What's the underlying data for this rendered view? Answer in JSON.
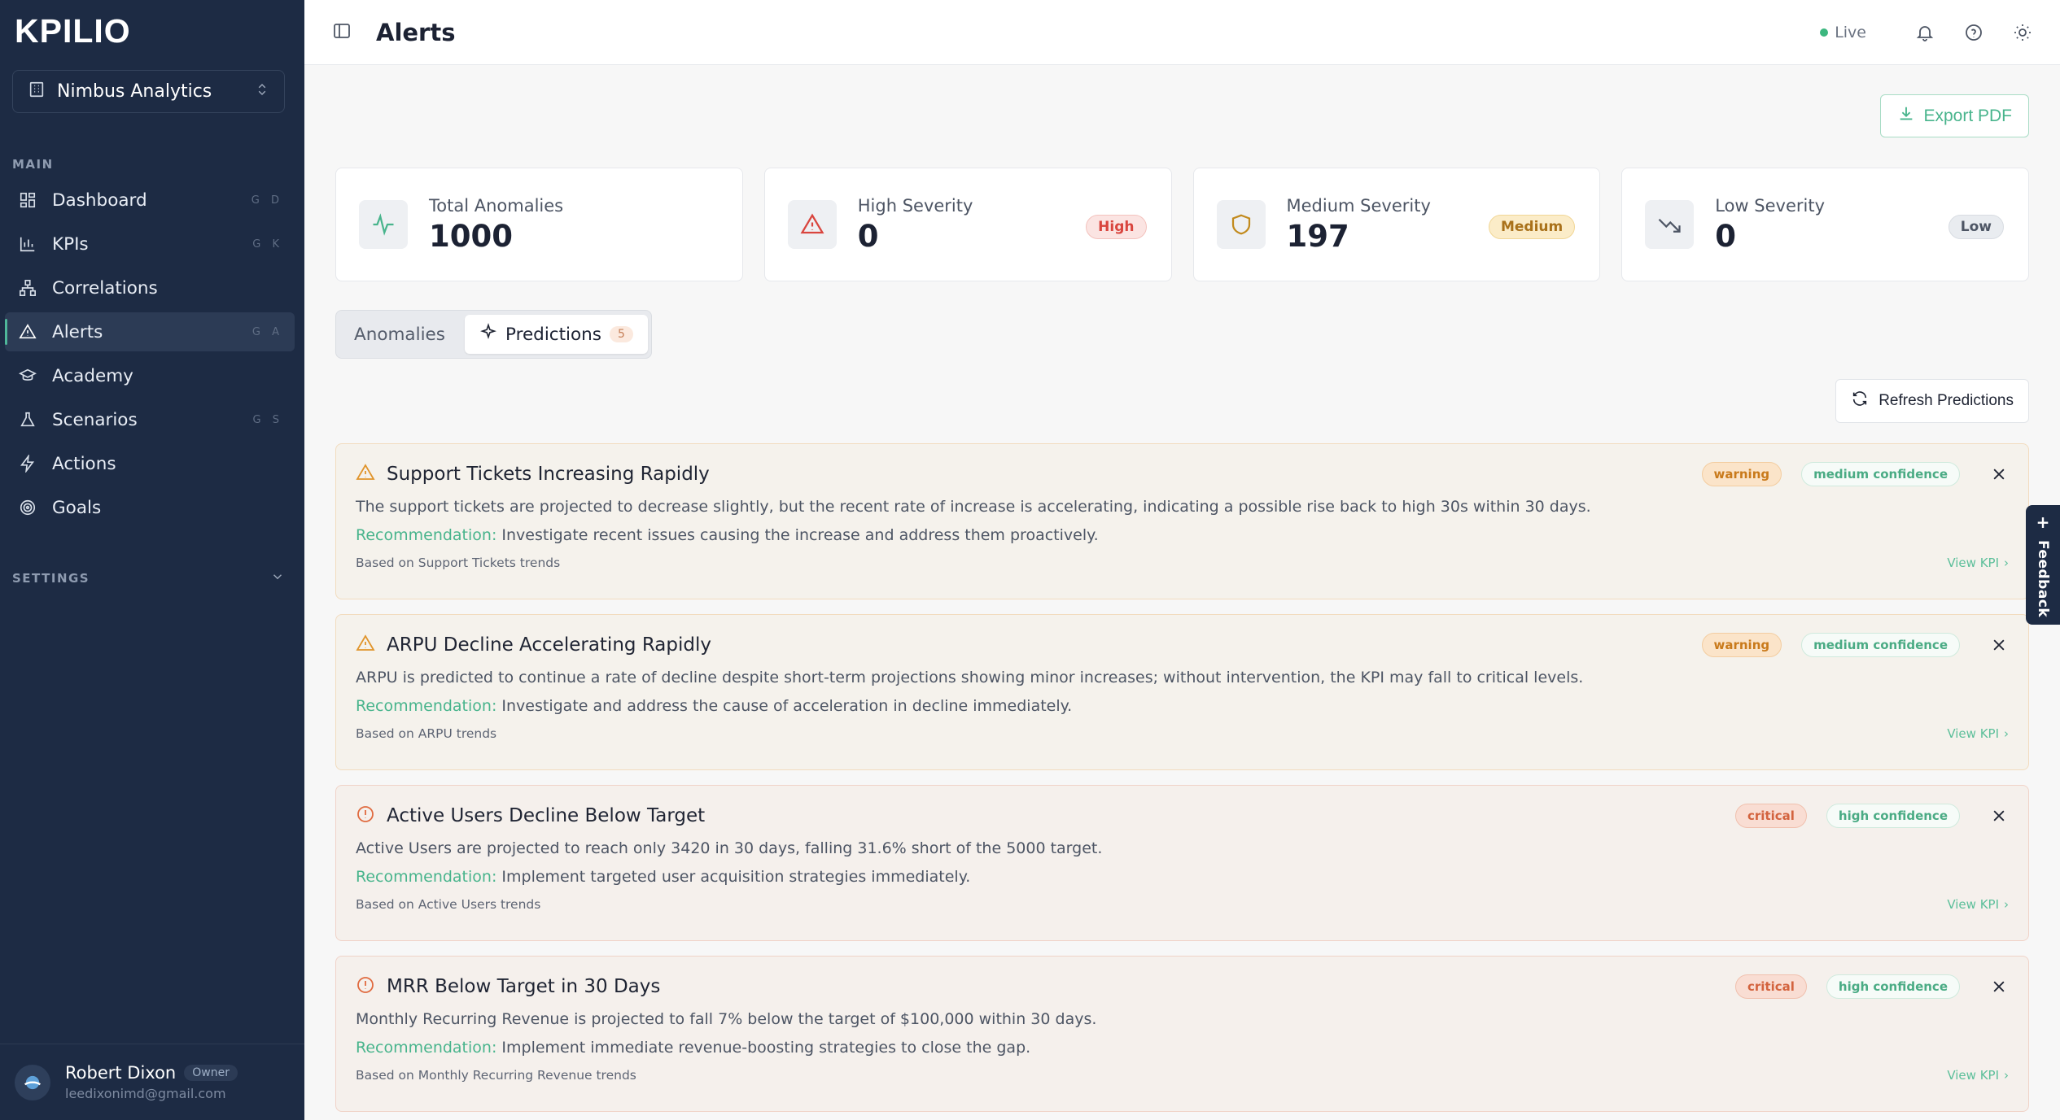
{
  "brand": {
    "logo_text": "KPILIO"
  },
  "org": {
    "name": "Nimbus Analytics"
  },
  "sidebar": {
    "main_label": "MAIN",
    "items": [
      {
        "label": "Dashboard",
        "shortcut": "G D",
        "icon": "grid-icon"
      },
      {
        "label": "KPIs",
        "shortcut": "G K",
        "icon": "bar-chart-icon"
      },
      {
        "label": "Correlations",
        "shortcut": "",
        "icon": "network-icon"
      },
      {
        "label": "Alerts",
        "shortcut": "G A",
        "icon": "alert-triangle-icon",
        "active": true
      },
      {
        "label": "Academy",
        "shortcut": "",
        "icon": "graduation-cap-icon"
      },
      {
        "label": "Scenarios",
        "shortcut": "G S",
        "icon": "flask-icon"
      },
      {
        "label": "Actions",
        "shortcut": "",
        "icon": "zap-icon"
      },
      {
        "label": "Goals",
        "shortcut": "",
        "icon": "target-icon"
      }
    ],
    "settings_label": "SETTINGS"
  },
  "user": {
    "name": "Robert Dixon",
    "role": "Owner",
    "email": "leedixonimd@gmail.com"
  },
  "header": {
    "title": "Alerts",
    "live_label": "Live"
  },
  "export_label": "Export PDF",
  "stats": [
    {
      "label": "Total Anomalies",
      "value": "1000",
      "badge": ""
    },
    {
      "label": "High Severity",
      "value": "0",
      "badge": "High"
    },
    {
      "label": "Medium Severity",
      "value": "197",
      "badge": "Medium"
    },
    {
      "label": "Low Severity",
      "value": "0",
      "badge": "Low"
    }
  ],
  "tabs": {
    "anomalies": "Anomalies",
    "predictions": "Predictions",
    "predictions_count": "5"
  },
  "refresh_label": "Refresh Predictions",
  "alerts": [
    {
      "title": "Support Tickets Increasing Rapidly",
      "severity": "warning",
      "confidence": "medium confidence",
      "description": "The support tickets are projected to decrease slightly, but the recent rate of increase is accelerating, indicating a possible rise back to high 30s within 30 days.",
      "rec_label": "Recommendation:",
      "recommendation": "Investigate recent issues causing the increase and address them proactively.",
      "based_on": "Based on Support Tickets trends",
      "view": "View KPI"
    },
    {
      "title": "ARPU Decline Accelerating Rapidly",
      "severity": "warning",
      "confidence": "medium confidence",
      "description": "ARPU is predicted to continue a rate of decline despite short-term projections showing minor increases; without intervention, the KPI may fall to critical levels.",
      "rec_label": "Recommendation:",
      "recommendation": "Investigate and address the cause of acceleration in decline immediately.",
      "based_on": "Based on ARPU trends",
      "view": "View KPI"
    },
    {
      "title": "Active Users Decline Below Target",
      "severity": "critical",
      "confidence": "high confidence",
      "description": "Active Users are projected to reach only 3420 in 30 days, falling 31.6% short of the 5000 target.",
      "rec_label": "Recommendation:",
      "recommendation": "Implement targeted user acquisition strategies immediately.",
      "based_on": "Based on Active Users trends",
      "view": "View KPI"
    },
    {
      "title": "MRR Below Target in 30 Days",
      "severity": "critical",
      "confidence": "high confidence",
      "description": "Monthly Recurring Revenue is projected to fall 7% below the target of $100,000 within 30 days.",
      "rec_label": "Recommendation:",
      "recommendation": "Implement immediate revenue-boosting strategies to close the gap.",
      "based_on": "Based on Monthly Recurring Revenue trends",
      "view": "View KPI"
    }
  ],
  "feedback_label": "Feedback",
  "colors": {
    "accent": "#48b48c",
    "sidebar": "#1d2b44",
    "warning": "#c97a1b",
    "critical": "#d3633e"
  }
}
